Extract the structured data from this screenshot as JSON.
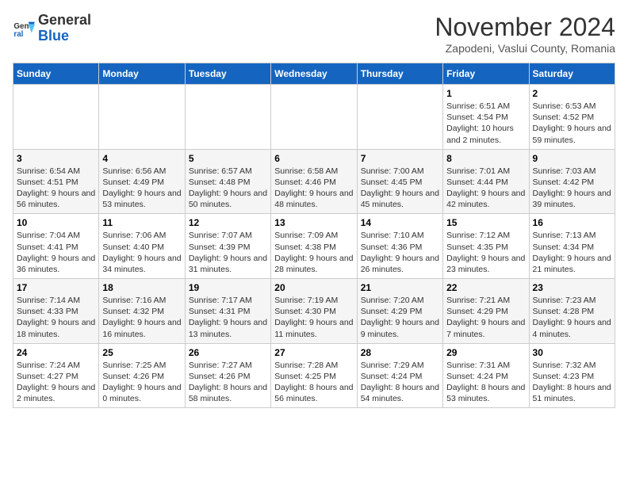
{
  "logo": {
    "text_general": "General",
    "text_blue": "Blue"
  },
  "header": {
    "month": "November 2024",
    "location": "Zapodeni, Vaslui County, Romania"
  },
  "days_of_week": [
    "Sunday",
    "Monday",
    "Tuesday",
    "Wednesday",
    "Thursday",
    "Friday",
    "Saturday"
  ],
  "weeks": [
    [
      {
        "day": "",
        "info": ""
      },
      {
        "day": "",
        "info": ""
      },
      {
        "day": "",
        "info": ""
      },
      {
        "day": "",
        "info": ""
      },
      {
        "day": "",
        "info": ""
      },
      {
        "day": "1",
        "info": "Sunrise: 6:51 AM\nSunset: 4:54 PM\nDaylight: 10 hours and 2 minutes."
      },
      {
        "day": "2",
        "info": "Sunrise: 6:53 AM\nSunset: 4:52 PM\nDaylight: 9 hours and 59 minutes."
      }
    ],
    [
      {
        "day": "3",
        "info": "Sunrise: 6:54 AM\nSunset: 4:51 PM\nDaylight: 9 hours and 56 minutes."
      },
      {
        "day": "4",
        "info": "Sunrise: 6:56 AM\nSunset: 4:49 PM\nDaylight: 9 hours and 53 minutes."
      },
      {
        "day": "5",
        "info": "Sunrise: 6:57 AM\nSunset: 4:48 PM\nDaylight: 9 hours and 50 minutes."
      },
      {
        "day": "6",
        "info": "Sunrise: 6:58 AM\nSunset: 4:46 PM\nDaylight: 9 hours and 48 minutes."
      },
      {
        "day": "7",
        "info": "Sunrise: 7:00 AM\nSunset: 4:45 PM\nDaylight: 9 hours and 45 minutes."
      },
      {
        "day": "8",
        "info": "Sunrise: 7:01 AM\nSunset: 4:44 PM\nDaylight: 9 hours and 42 minutes."
      },
      {
        "day": "9",
        "info": "Sunrise: 7:03 AM\nSunset: 4:42 PM\nDaylight: 9 hours and 39 minutes."
      }
    ],
    [
      {
        "day": "10",
        "info": "Sunrise: 7:04 AM\nSunset: 4:41 PM\nDaylight: 9 hours and 36 minutes."
      },
      {
        "day": "11",
        "info": "Sunrise: 7:06 AM\nSunset: 4:40 PM\nDaylight: 9 hours and 34 minutes."
      },
      {
        "day": "12",
        "info": "Sunrise: 7:07 AM\nSunset: 4:39 PM\nDaylight: 9 hours and 31 minutes."
      },
      {
        "day": "13",
        "info": "Sunrise: 7:09 AM\nSunset: 4:38 PM\nDaylight: 9 hours and 28 minutes."
      },
      {
        "day": "14",
        "info": "Sunrise: 7:10 AM\nSunset: 4:36 PM\nDaylight: 9 hours and 26 minutes."
      },
      {
        "day": "15",
        "info": "Sunrise: 7:12 AM\nSunset: 4:35 PM\nDaylight: 9 hours and 23 minutes."
      },
      {
        "day": "16",
        "info": "Sunrise: 7:13 AM\nSunset: 4:34 PM\nDaylight: 9 hours and 21 minutes."
      }
    ],
    [
      {
        "day": "17",
        "info": "Sunrise: 7:14 AM\nSunset: 4:33 PM\nDaylight: 9 hours and 18 minutes."
      },
      {
        "day": "18",
        "info": "Sunrise: 7:16 AM\nSunset: 4:32 PM\nDaylight: 9 hours and 16 minutes."
      },
      {
        "day": "19",
        "info": "Sunrise: 7:17 AM\nSunset: 4:31 PM\nDaylight: 9 hours and 13 minutes."
      },
      {
        "day": "20",
        "info": "Sunrise: 7:19 AM\nSunset: 4:30 PM\nDaylight: 9 hours and 11 minutes."
      },
      {
        "day": "21",
        "info": "Sunrise: 7:20 AM\nSunset: 4:29 PM\nDaylight: 9 hours and 9 minutes."
      },
      {
        "day": "22",
        "info": "Sunrise: 7:21 AM\nSunset: 4:29 PM\nDaylight: 9 hours and 7 minutes."
      },
      {
        "day": "23",
        "info": "Sunrise: 7:23 AM\nSunset: 4:28 PM\nDaylight: 9 hours and 4 minutes."
      }
    ],
    [
      {
        "day": "24",
        "info": "Sunrise: 7:24 AM\nSunset: 4:27 PM\nDaylight: 9 hours and 2 minutes."
      },
      {
        "day": "25",
        "info": "Sunrise: 7:25 AM\nSunset: 4:26 PM\nDaylight: 9 hours and 0 minutes."
      },
      {
        "day": "26",
        "info": "Sunrise: 7:27 AM\nSunset: 4:26 PM\nDaylight: 8 hours and 58 minutes."
      },
      {
        "day": "27",
        "info": "Sunrise: 7:28 AM\nSunset: 4:25 PM\nDaylight: 8 hours and 56 minutes."
      },
      {
        "day": "28",
        "info": "Sunrise: 7:29 AM\nSunset: 4:24 PM\nDaylight: 8 hours and 54 minutes."
      },
      {
        "day": "29",
        "info": "Sunrise: 7:31 AM\nSunset: 4:24 PM\nDaylight: 8 hours and 53 minutes."
      },
      {
        "day": "30",
        "info": "Sunrise: 7:32 AM\nSunset: 4:23 PM\nDaylight: 8 hours and 51 minutes."
      }
    ]
  ]
}
